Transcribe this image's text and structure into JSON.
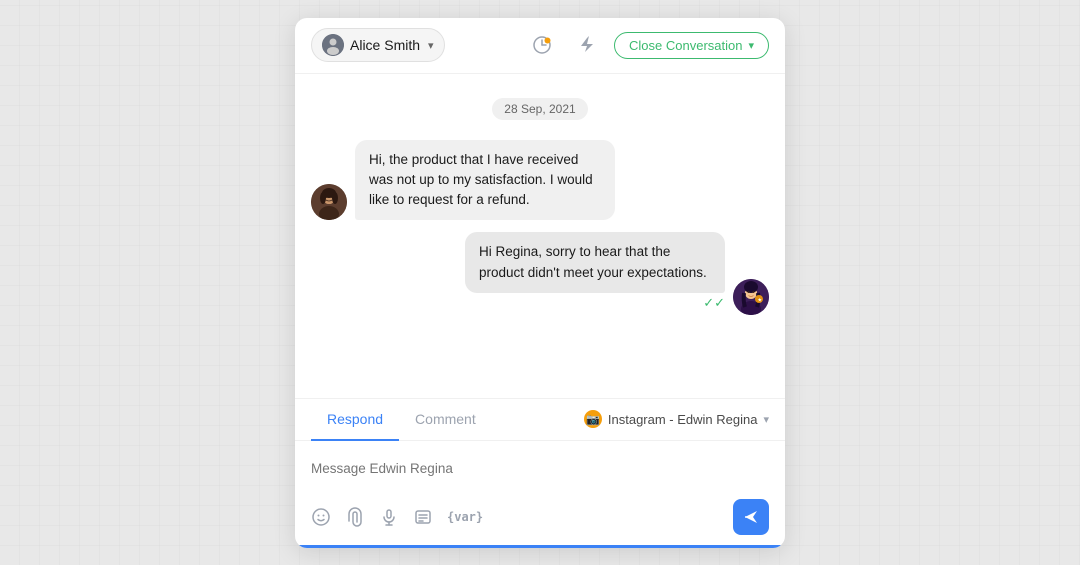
{
  "header": {
    "contact_name": "Alice Smith",
    "close_button_label": "Close Conversation",
    "chevron": "▾"
  },
  "date_separator": "28 Sep, 2021",
  "messages": [
    {
      "id": 1,
      "direction": "incoming",
      "text": "Hi, the product that I have received was not up to my satisfaction. I would like to request for a refund.",
      "avatar_emoji": "👤"
    },
    {
      "id": 2,
      "direction": "outgoing",
      "text": "Hi Regina, sorry to hear that the product didn't meet your expectations.",
      "avatar_emoji": "👩",
      "read": true
    }
  ],
  "reply": {
    "tabs": [
      {
        "id": "respond",
        "label": "Respond",
        "active": true
      },
      {
        "id": "comment",
        "label": "Comment",
        "active": false
      }
    ],
    "inbox_label": "Instagram - Edwin Regina",
    "inbox_icon": "📷",
    "placeholder": "Message Edwin Regina",
    "toolbar_icons": [
      {
        "name": "emoji",
        "symbol": "☺"
      },
      {
        "name": "attachment",
        "symbol": "⬆"
      },
      {
        "name": "audio",
        "symbol": "🎙"
      },
      {
        "name": "template",
        "symbol": "▤"
      },
      {
        "name": "variable",
        "symbol": "{var}"
      }
    ],
    "send_icon": "➤"
  }
}
